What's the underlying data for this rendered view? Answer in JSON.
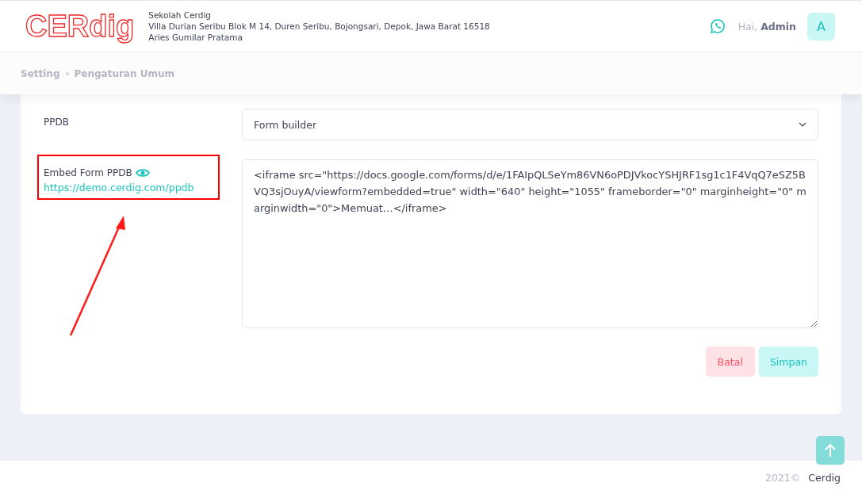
{
  "header": {
    "logo": "CERdig",
    "school_name": "Sekolah Cerdig",
    "address": "Villa Durian Seribu Blok M 14, Duren Seribu, Bojongsari, Depok, Jawa Barat 16518",
    "principal": "Aries Gumilar Pratama",
    "greeting": "Hai,",
    "user_name": "Admin",
    "avatar_letter": "A"
  },
  "breadcrumb": [
    "Setting",
    "Pengaturan Umum"
  ],
  "form": {
    "fields": [
      {
        "kind": "select",
        "label": "PPDB",
        "value": "Form builder",
        "highlighted": false
      },
      {
        "kind": "textarea",
        "label": "Embed Form PPDB",
        "link": "https://demo.cerdig.com/ppdb",
        "value": "<iframe src=\"https://docs.google.com/forms/d/e/1FAIpQLSeYm86VN6oPDJVkocYSHJRF1sg1c1F4VqQ7eSZ5BVQ3sjOuyA/viewform?embedded=true\" width=\"640\" height=\"1055\" frameborder=\"0\" marginheight=\"0\" marginwidth=\"0\">Memuat…</iframe>",
        "highlighted": true
      }
    ],
    "buttons": [
      {
        "label": "Batal",
        "kind": "cancel"
      },
      {
        "label": "Simpan",
        "kind": "save"
      }
    ]
  },
  "footer": {
    "year": "2021©",
    "brand": "Cerdig"
  }
}
